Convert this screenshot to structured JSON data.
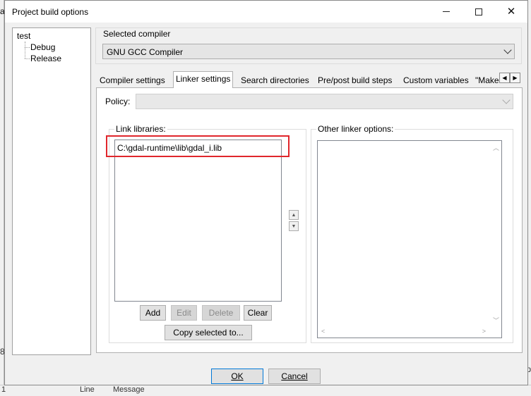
{
  "background": {
    "left_char": "a",
    "right_char": "p",
    "left_bottom_char": "8",
    "bottom_text_1": "1",
    "bottom_text_2": "Line",
    "bottom_text_3": "Message"
  },
  "window": {
    "title": "Project build options",
    "minimize_label": "Minimize",
    "maximize_label": "Maximize",
    "close_glyph": "✕"
  },
  "tree": {
    "root": "test",
    "children": [
      "Debug",
      "Release"
    ]
  },
  "compiler": {
    "group_label": "Selected compiler",
    "selected": "GNU GCC Compiler"
  },
  "tabs": [
    {
      "label": "Compiler settings",
      "selected": false
    },
    {
      "label": "Linker settings",
      "selected": true
    },
    {
      "label": "Search directories",
      "selected": false
    },
    {
      "label": "Pre/post build steps",
      "selected": false
    },
    {
      "label": "Custom variables",
      "selected": false
    },
    {
      "label": "\"Make",
      "selected": false
    }
  ],
  "tab_scroll": {
    "left": "◀",
    "right": "▶"
  },
  "linker": {
    "policy_label": "Policy:",
    "policy_value": "",
    "link_libraries_label": "Link libraries:",
    "link_libraries": [
      "C:\\gdal-runtime\\lib\\gdal_i.lib"
    ],
    "add_label": "Add",
    "edit_label": "Edit",
    "delete_label": "Delete",
    "clear_label": "Clear",
    "copy_label": "Copy selected to...",
    "up_glyph": "▲",
    "down_glyph": "▼",
    "other_options_label": "Other linker options:",
    "other_options_value": ""
  },
  "footer": {
    "ok_label": "OK",
    "cancel_label": "Cancel"
  },
  "colors": {
    "highlight": "#e0262c",
    "dialog_bg": "#f0f0f0"
  }
}
